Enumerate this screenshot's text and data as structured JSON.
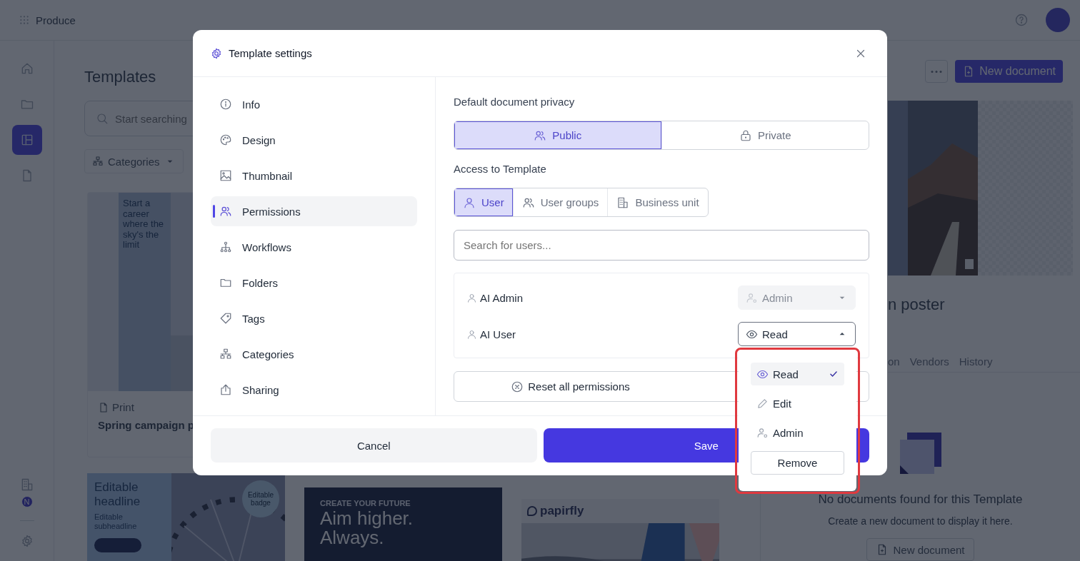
{
  "app": {
    "name": "Produce"
  },
  "rail": {
    "items": [
      {
        "kind": "home",
        "selected": false
      },
      {
        "kind": "folder",
        "selected": false
      },
      {
        "kind": "layout",
        "selected": true
      },
      {
        "kind": "file",
        "selected": false
      }
    ],
    "badge": "N"
  },
  "page": {
    "title": "Templates",
    "search": {
      "placeholder": "Start searching"
    },
    "filters": [
      {
        "label": "Categories"
      }
    ]
  },
  "cards": [
    {
      "type": "Print",
      "title": "Spring campaign p",
      "thumb_text": "Start a career where the sky's the limit"
    }
  ],
  "more_cards": [
    {
      "kind": "editable",
      "headline": "Editable headline",
      "subheadline": "Editable subheadline",
      "badge": "Editable badge"
    },
    {
      "kind": "dark",
      "eyebrow": "CREATE YOUR FUTURE",
      "headline": "Aim higher. Always."
    },
    {
      "kind": "logo",
      "logo": "papirfly"
    }
  ],
  "detail": {
    "new_button": "New document",
    "title": "n poster",
    "tabs": [
      {
        "label": "on"
      },
      {
        "label": "Vendors"
      },
      {
        "label": "History"
      }
    ],
    "empty": {
      "title": "No documents found for this Template",
      "text": "Create a new document to display it here.",
      "button": "New document"
    }
  },
  "modal": {
    "title": "Template settings",
    "nav": [
      {
        "label": "Info",
        "selected": false
      },
      {
        "label": "Design",
        "selected": false
      },
      {
        "label": "Thumbnail",
        "selected": false
      },
      {
        "label": "Permissions",
        "selected": true
      },
      {
        "label": "Workflows",
        "selected": false
      },
      {
        "label": "Folders",
        "selected": false
      },
      {
        "label": "Tags",
        "selected": false
      },
      {
        "label": "Categories",
        "selected": false
      },
      {
        "label": "Sharing",
        "selected": false
      }
    ],
    "privacy": {
      "label": "Default document privacy",
      "options": [
        {
          "label": "Public",
          "selected": true
        },
        {
          "label": "Private",
          "selected": false
        }
      ]
    },
    "access": {
      "label": "Access to Template",
      "tabs": [
        {
          "label": "User",
          "selected": true
        },
        {
          "label": "User groups",
          "selected": false
        },
        {
          "label": "Business unit",
          "selected": false
        }
      ],
      "search": {
        "placeholder": "Search for users..."
      },
      "users": [
        {
          "name": "AI Admin",
          "role": "Admin",
          "disabled": true,
          "expanded": false
        },
        {
          "name": "AI User",
          "role": "Read",
          "disabled": false,
          "expanded": true
        }
      ],
      "reset": "Reset all permissions"
    },
    "cancel": "Cancel",
    "save": "Save"
  },
  "menu": {
    "highlighted": true,
    "items": [
      {
        "label": "Read",
        "selected": true
      },
      {
        "label": "Edit",
        "selected": false
      },
      {
        "label": "Admin",
        "selected": false
      }
    ],
    "remove": "Remove"
  }
}
